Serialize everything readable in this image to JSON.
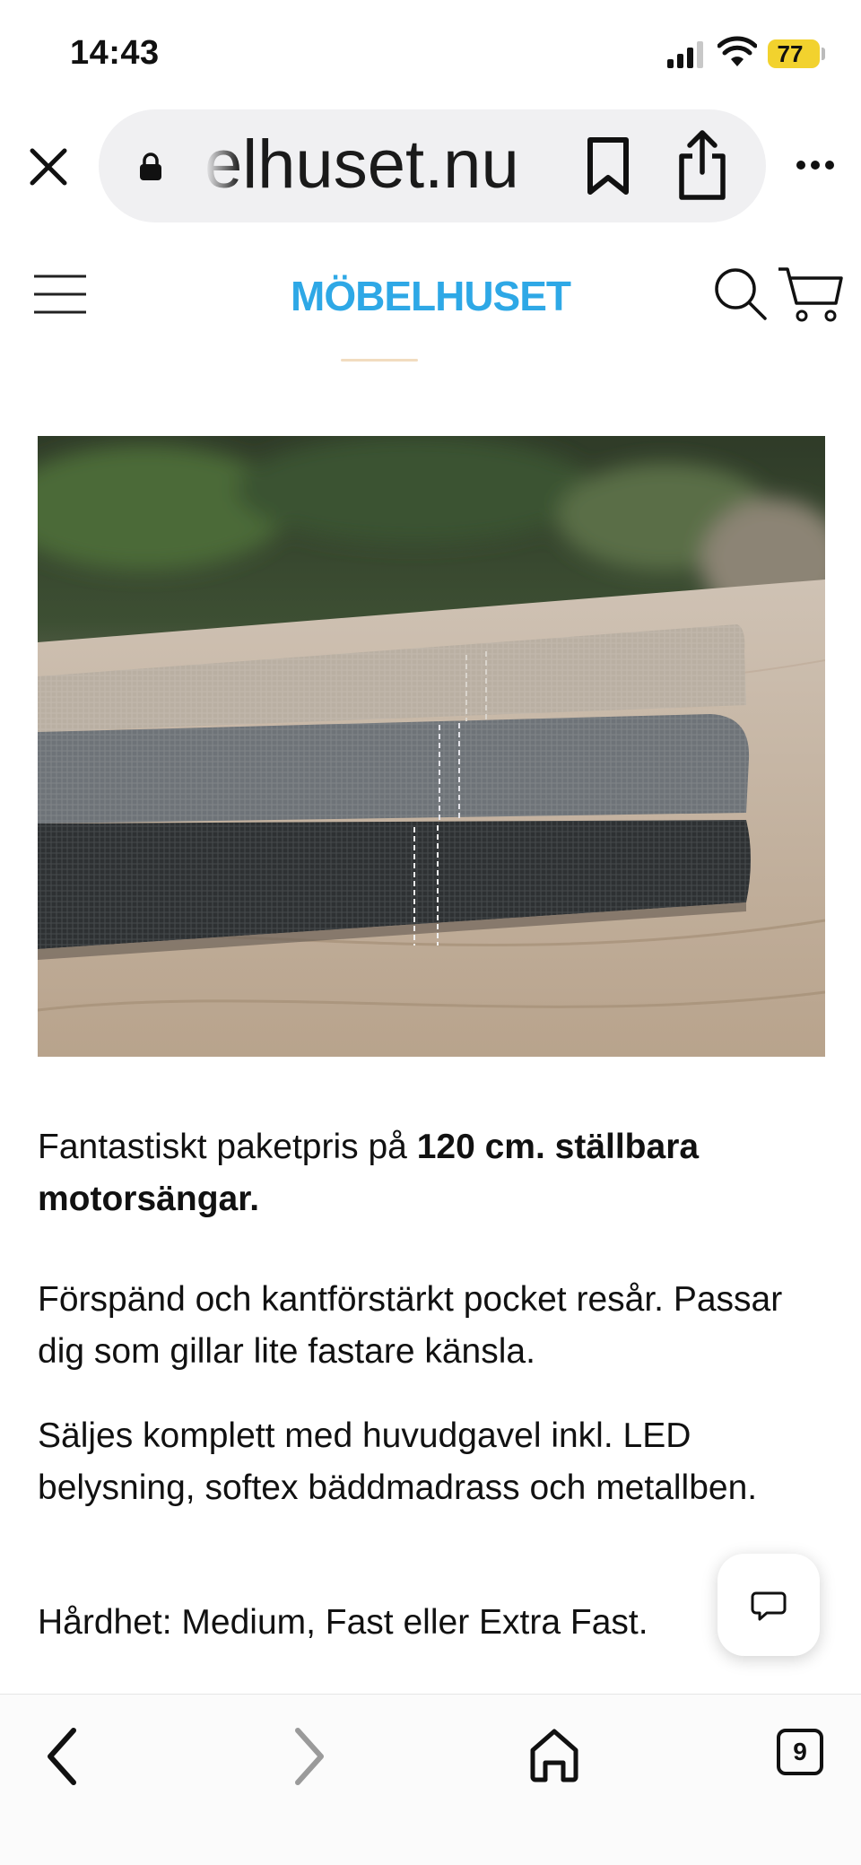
{
  "status_bar": {
    "time": "14:43",
    "battery_level": "77",
    "icons": [
      "signal-icon",
      "wifi-icon",
      "battery-icon"
    ]
  },
  "browser": {
    "url_display": "elhuset.nu",
    "icons": [
      "close-icon",
      "lock-icon",
      "bookmark-icon",
      "share-icon",
      "more-icon"
    ]
  },
  "site_header": {
    "logo_text": "MÖBELHUSET",
    "logo_color": "#2ea8e6",
    "icons": [
      "menu-icon",
      "search-icon",
      "cart-icon"
    ]
  },
  "product": {
    "image_alt": "fabric-samples-image",
    "description": {
      "p1_prefix": "Fantastiskt paketpris på ",
      "p1_bold": "120 cm. ställbara motorsängar.",
      "p2": "Förspänd och kantförstärkt pocket resår. Passar dig som gillar lite fastare känsla.",
      "p3": "Säljes komplett med huvudgavel inkl. LED belysning, softex bäddmadrass och metallben.",
      "p4": "Hårdhet: Medium, Fast eller Extra Fast."
    }
  },
  "chat": {
    "icon": "chat-icon"
  },
  "toolbar": {
    "tab_count": "9",
    "icons": [
      "back-icon",
      "forward-icon",
      "home-icon",
      "tabs-icon"
    ]
  }
}
